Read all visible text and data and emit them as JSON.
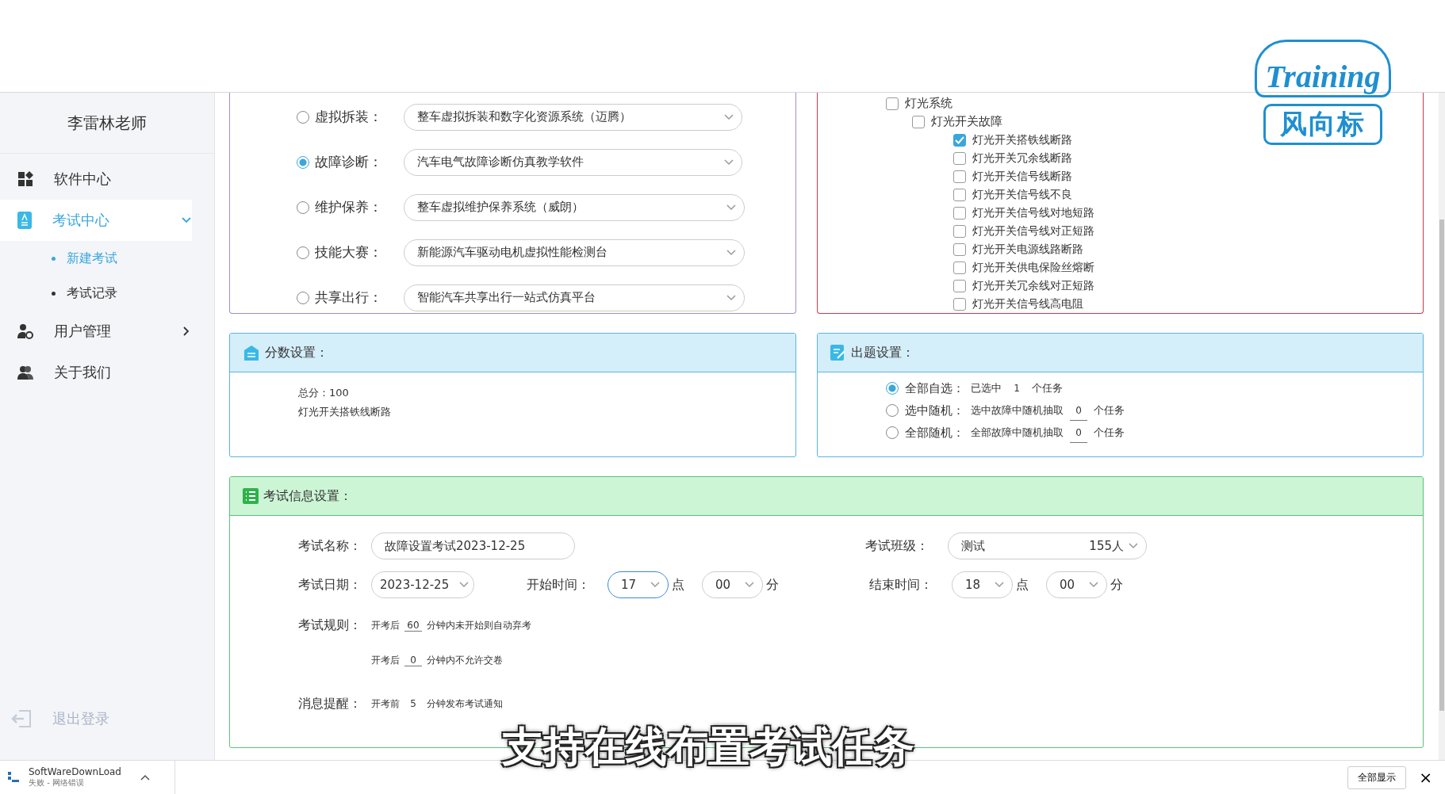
{
  "logo": {
    "wordmark": "Training",
    "brand": "风向标"
  },
  "sidebar": {
    "user": "李雷林老师",
    "items": [
      {
        "label": "软件中心",
        "kind": "link",
        "selected": false
      },
      {
        "label": "考试中心",
        "kind": "group",
        "selected": true,
        "expanded": true,
        "children": [
          {
            "label": "新建考试",
            "selected": true
          },
          {
            "label": "考试记录",
            "selected": false
          }
        ]
      },
      {
        "label": "用户管理",
        "kind": "group",
        "selected": false,
        "expanded": false
      },
      {
        "label": "关于我们",
        "kind": "link",
        "selected": false
      }
    ],
    "logout": "退出登录"
  },
  "software": [
    {
      "label": "虚拟拆装：",
      "value": "整车虚拟拆装和数字化资源系统（迈腾）",
      "selected": false
    },
    {
      "label": "故障诊断：",
      "value": "汽车电气故障诊断仿真教学软件",
      "selected": true
    },
    {
      "label": "维护保养：",
      "value": "整车虚拟维护保养系统（威朗）",
      "selected": false
    },
    {
      "label": "技能大赛：",
      "value": "新能源汽车驱动电机虚拟性能检测台",
      "selected": false
    },
    {
      "label": "共享出行：",
      "value": "智能汽车共享出行一站式仿真平台",
      "selected": false
    }
  ],
  "faults": [
    {
      "label": "灯光系统",
      "checked": false,
      "children": [
        {
          "label": "灯光开关故障",
          "checked": false,
          "children": [
            {
              "label": "灯光开关搭铁线断路",
              "checked": true
            },
            {
              "label": "灯光开关冗余线断路",
              "checked": false
            },
            {
              "label": "灯光开关信号线断路",
              "checked": false
            },
            {
              "label": "灯光开关信号线不良",
              "checked": false
            },
            {
              "label": "灯光开关信号线对地短路",
              "checked": false
            },
            {
              "label": "灯光开关信号线对正短路",
              "checked": false
            },
            {
              "label": "灯光开关电源线路断路",
              "checked": false
            },
            {
              "label": "灯光开关供电保险丝熔断",
              "checked": false
            },
            {
              "label": "灯光开关冗余线对正短路",
              "checked": false
            },
            {
              "label": "灯光开关信号线高电阻",
              "checked": false
            }
          ]
        }
      ]
    }
  ],
  "score": {
    "title": "分数设置：",
    "total": "总分：100",
    "items": [
      "灯光开关搭铁线断路"
    ]
  },
  "questions": {
    "title": "出题设置：",
    "modes": [
      {
        "label": "全部自选：",
        "before": "已选中",
        "count": "1",
        "after": "个任务",
        "underlined": false,
        "selected": true
      },
      {
        "label": "选中随机：",
        "before": "选中故障中随机抽取",
        "count": "0",
        "after": "个任务",
        "underlined": true,
        "selected": false
      },
      {
        "label": "全部随机：",
        "before": "全部故障中随机抽取",
        "count": "0",
        "after": "个任务",
        "underlined": true,
        "selected": false
      }
    ]
  },
  "exam_info": {
    "title": "考试信息设置：",
    "name_label": "考试名称：",
    "name_value": "故障设置考试2023-12-25",
    "class_label": "考试班级：",
    "class_value": "测试",
    "class_count": "155人",
    "date_label": "考试日期：",
    "date_value": "2023-12-25",
    "start_label": "开始时间：",
    "start_hour": "17",
    "start_hour_focused": true,
    "hour_unit": "点",
    "start_minute": "00",
    "minute_unit": "分",
    "end_label": "结束时间：",
    "end_hour": "18",
    "end_hour_unit": "点",
    "end_minute": "00",
    "end_minute_unit": "分",
    "rules_label": "考试规则：",
    "rules": [
      {
        "before": "开考后",
        "value": "60",
        "after": "分钟内未开始则自动弃考"
      },
      {
        "before": "开考后",
        "value": "0",
        "after": "分钟内不允许交卷"
      }
    ],
    "notify_label": "消息提醒：",
    "notify": {
      "before": "开考前",
      "value": "5",
      "after": "分钟发布考试通知"
    }
  },
  "caption": "支持在线布置考试任务",
  "download_bar": {
    "file": "SoftWareDownLoad",
    "status": "失败 - 网络错误",
    "show_all": "全部显示",
    "close": "×"
  }
}
